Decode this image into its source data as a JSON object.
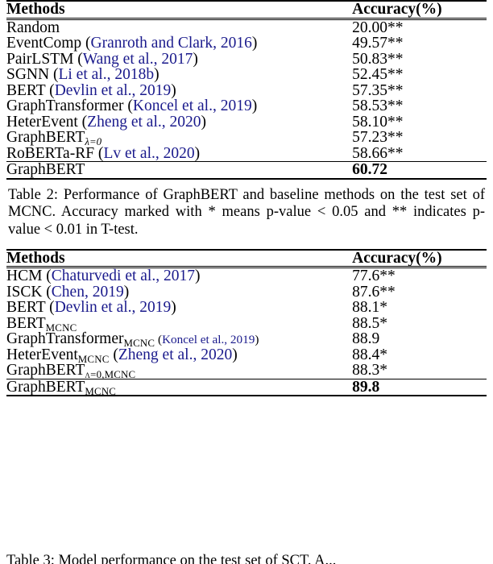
{
  "table2": {
    "headers": {
      "methods": "Methods",
      "accuracy": "Accuracy(%)"
    },
    "rows": [
      {
        "name": "Random",
        "cite": "",
        "value": "20.00**"
      },
      {
        "name": "EventComp (",
        "cite": "Granroth and Clark, 2016",
        "close": ")",
        "value": "49.57**"
      },
      {
        "name": "PairLSTM (",
        "cite": "Wang et al., 2017",
        "close": ")",
        "value": "50.83**"
      },
      {
        "name": "SGNN (",
        "cite": "Li et al., 2018b",
        "close": ")",
        "value": "52.45**"
      },
      {
        "name": "BERT (",
        "cite": "Devlin et al., 2019",
        "close": ")",
        "value": "57.35**"
      },
      {
        "name": "GraphTransformer (",
        "cite": "Koncel et al., 2019",
        "close": ")",
        "value": "58.53**"
      },
      {
        "name": "HeterEvent (",
        "cite": "Zheng et al., 2020",
        "close": ")",
        "value": "58.10**"
      },
      {
        "name": "GraphBERT",
        "sub": "λ=0",
        "cite": "",
        "value": "57.23**"
      },
      {
        "name": "RoBERTa-RF (",
        "cite": "Lv et al., 2020",
        "close": ")",
        "value": "58.66**"
      }
    ],
    "best_row": {
      "name": "GraphBERT",
      "value": "60.72"
    },
    "caption": "Table 2: Performance of GraphBERT and baseline methods on the test set of MCNC. Accuracy marked with * means p-value < 0.05 and ** indicates p-value < 0.01 in T-test."
  },
  "table3": {
    "headers": {
      "methods": "Methods",
      "accuracy": "Accuracy(%)"
    },
    "rows": [
      {
        "name": "HCM (",
        "cite": "Chaturvedi et al., 2017",
        "close": ")",
        "value": "77.6**"
      },
      {
        "name": "ISCK (",
        "cite": "Chen, 2019",
        "close": ")",
        "value": "87.6**"
      },
      {
        "name": "BERT (",
        "cite": "Devlin et al., 2019",
        "close": ")",
        "value": "88.1*"
      },
      {
        "name": "BERT",
        "sub": "MCNC",
        "cite": "",
        "value": "88.5*"
      },
      {
        "name": "GraphTransformer",
        "sub": "MCNC",
        "cite": "Koncel et al., 2019",
        "open_small": " (",
        "close": ")",
        "small_cite": true,
        "value": "88.9"
      },
      {
        "name": "HeterEvent",
        "sub": "MCNC",
        "cite": "Zheng et al., 2020",
        "open_small": " (",
        "close": ")",
        "value": "88.4*"
      },
      {
        "name": "GraphBERT",
        "sub": "λ=0,MCNC",
        "cite": "",
        "value": "88.3*"
      }
    ],
    "best_row": {
      "name": "GraphBERT",
      "sub": "MCNC",
      "value": "89.8"
    },
    "caption": "Table 3: Model performance on the test set of SCT. A..."
  }
}
